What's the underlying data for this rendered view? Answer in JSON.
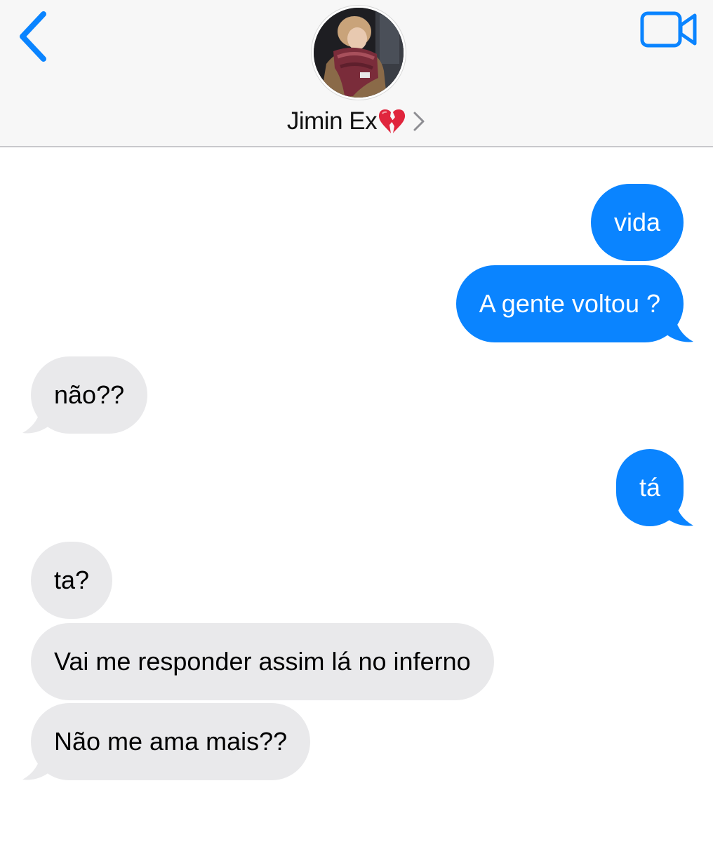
{
  "header": {
    "contact_name": "Jimin Ex",
    "back_icon": "chevron-left-icon",
    "video_icon": "video-camera-icon",
    "name_emoji": "broken-heart-icon",
    "accent_color": "#0a84ff"
  },
  "messages": [
    {
      "side": "sent",
      "text": "vida"
    },
    {
      "side": "sent",
      "text": "A gente voltou ?"
    },
    {
      "side": "received",
      "text": "não??"
    },
    {
      "side": "sent",
      "text": "tá"
    },
    {
      "side": "received",
      "text": "ta?"
    },
    {
      "side": "received",
      "text": "Vai me responder assim lá no inferno"
    },
    {
      "side": "received",
      "text": "Não me ama mais??"
    }
  ],
  "colors": {
    "sent_bubble": "#0a84ff",
    "received_bubble": "#e9e9eb"
  }
}
